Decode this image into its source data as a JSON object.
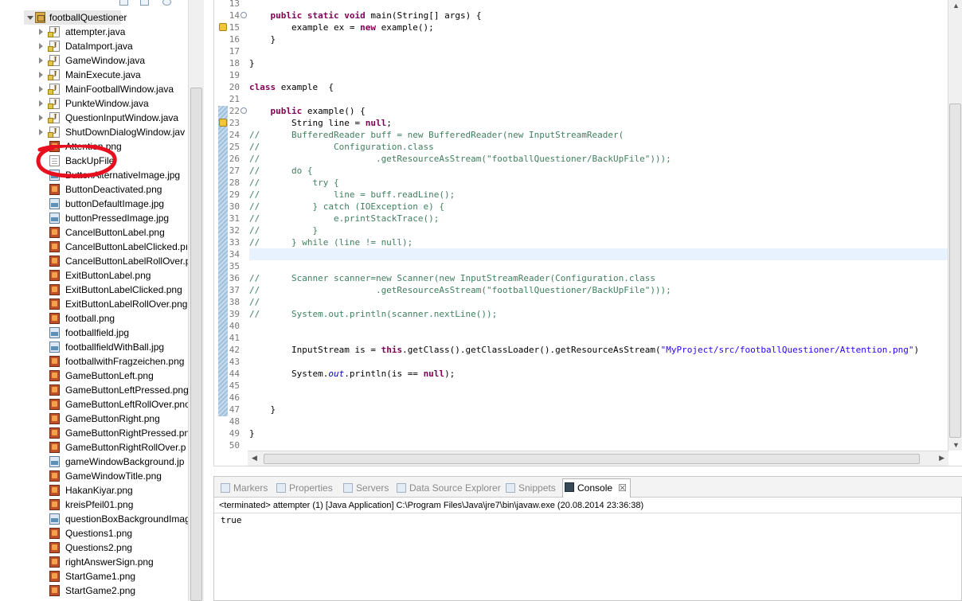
{
  "explorer": {
    "project": "footballQuestioner",
    "items": [
      {
        "label": "attempter.java",
        "type": "java",
        "expandable": true
      },
      {
        "label": "DataImport.java",
        "type": "java",
        "expandable": true
      },
      {
        "label": "GameWindow.java",
        "type": "java",
        "expandable": true
      },
      {
        "label": "MainExecute.java",
        "type": "java",
        "expandable": true
      },
      {
        "label": "MainFootballWindow.java",
        "type": "java",
        "expandable": true
      },
      {
        "label": "PunkteWindow.java",
        "type": "java",
        "expandable": true
      },
      {
        "label": "QuestionInputWindow.java",
        "type": "java",
        "expandable": true
      },
      {
        "label": "ShutDownDialogWindow.jav",
        "type": "java",
        "expandable": true
      },
      {
        "label": "Attention.png",
        "type": "png"
      },
      {
        "label": "BackUpFile",
        "type": "file"
      },
      {
        "label": "ButtonAlternativeImage.jpg",
        "type": "jpg"
      },
      {
        "label": "ButtonDeactivated.png",
        "type": "png"
      },
      {
        "label": "buttonDefaultImage.jpg",
        "type": "jpg"
      },
      {
        "label": "buttonPressedImage.jpg",
        "type": "jpg"
      },
      {
        "label": "CancelButtonLabel.png",
        "type": "png"
      },
      {
        "label": "CancelButtonLabelClicked.pı",
        "type": "png"
      },
      {
        "label": "CancelButtonLabelRollOver.p",
        "type": "png"
      },
      {
        "label": "ExitButtonLabel.png",
        "type": "png"
      },
      {
        "label": "ExitButtonLabelClicked.png",
        "type": "png"
      },
      {
        "label": "ExitButtonLabelRollOver.png",
        "type": "png"
      },
      {
        "label": "football.png",
        "type": "png"
      },
      {
        "label": "footballfield.jpg",
        "type": "jpg"
      },
      {
        "label": "footballfieldWithBall.jpg",
        "type": "jpg"
      },
      {
        "label": "footballwithFragzeichen.png",
        "type": "png"
      },
      {
        "label": "GameButtonLeft.png",
        "type": "png"
      },
      {
        "label": "GameButtonLeftPressed.png",
        "type": "png"
      },
      {
        "label": "GameButtonLeftRollOver.pno",
        "type": "png"
      },
      {
        "label": "GameButtonRight.png",
        "type": "png"
      },
      {
        "label": "GameButtonRightPressed.pn",
        "type": "png"
      },
      {
        "label": "GameButtonRightRollOver.p",
        "type": "png"
      },
      {
        "label": "gameWindowBackground.jp",
        "type": "jpg"
      },
      {
        "label": "GameWindowTitle.png",
        "type": "png"
      },
      {
        "label": "HakanKiyar.png",
        "type": "png"
      },
      {
        "label": "kreisPfeil01.png",
        "type": "png"
      },
      {
        "label": "questionBoxBackgroundImag",
        "type": "jpg"
      },
      {
        "label": "Questions1.png",
        "type": "png"
      },
      {
        "label": "Questions2.png",
        "type": "png"
      },
      {
        "label": "rightAnswerSign.png",
        "type": "png"
      },
      {
        "label": "StartGame1.png",
        "type": "png"
      },
      {
        "label": "StartGame2.png",
        "type": "png"
      }
    ]
  },
  "editor": {
    "lines": [
      {
        "n": "13",
        "tokens": []
      },
      {
        "n": "14",
        "fold": true,
        "tokens": [
          [
            "    ",
            ""
          ],
          [
            "public",
            "kw"
          ],
          [
            " ",
            ""
          ],
          [
            "static",
            "kw"
          ],
          [
            " ",
            ""
          ],
          [
            "void",
            "kw"
          ],
          [
            " main(String[] args) {",
            ""
          ]
        ]
      },
      {
        "n": "15",
        "warn": true,
        "tokens": [
          [
            "        example ex = ",
            ""
          ],
          [
            "new",
            "kw"
          ],
          [
            " example();",
            ""
          ]
        ]
      },
      {
        "n": "16",
        "tokens": [
          [
            "    }",
            ""
          ]
        ]
      },
      {
        "n": "17",
        "tokens": []
      },
      {
        "n": "18",
        "tokens": [
          [
            "}",
            ""
          ]
        ]
      },
      {
        "n": "19",
        "tokens": []
      },
      {
        "n": "20",
        "tokens": [
          [
            "class",
            "kw"
          ],
          [
            " example  {",
            ""
          ]
        ]
      },
      {
        "n": "21",
        "tokens": []
      },
      {
        "n": "22",
        "fold": true,
        "tokens": [
          [
            "    ",
            ""
          ],
          [
            "public",
            "kw"
          ],
          [
            " example() {",
            ""
          ]
        ]
      },
      {
        "n": "23",
        "warn": true,
        "tokens": [
          [
            "        String line = ",
            ""
          ],
          [
            "null",
            "kw"
          ],
          [
            ";",
            ""
          ]
        ]
      },
      {
        "n": "24",
        "tokens": [
          [
            "//      BufferedReader buff = new BufferedReader(new InputStreamReader(",
            "cm"
          ]
        ]
      },
      {
        "n": "25",
        "tokens": [
          [
            "//              Configuration.class",
            "cm"
          ]
        ]
      },
      {
        "n": "26",
        "tokens": [
          [
            "//                      .getResourceAsStream(\"footballQuestioner/BackUpFile\")));",
            "cm"
          ]
        ]
      },
      {
        "n": "27",
        "tokens": [
          [
            "//      do {",
            "cm"
          ]
        ]
      },
      {
        "n": "28",
        "tokens": [
          [
            "//          try {",
            "cm"
          ]
        ]
      },
      {
        "n": "29",
        "tokens": [
          [
            "//              line = buff.readLine();",
            "cm"
          ]
        ]
      },
      {
        "n": "30",
        "tokens": [
          [
            "//          } catch (IOException e) {",
            "cm"
          ]
        ]
      },
      {
        "n": "31",
        "tokens": [
          [
            "//              e.printStackTrace();",
            "cm"
          ]
        ]
      },
      {
        "n": "32",
        "tokens": [
          [
            "//          }",
            "cm"
          ]
        ]
      },
      {
        "n": "33",
        "tokens": [
          [
            "//      } while (line != null);",
            "cm"
          ]
        ]
      },
      {
        "n": "34",
        "tokens": []
      },
      {
        "n": "35",
        "tokens": []
      },
      {
        "n": "36",
        "tokens": [
          [
            "//      Scanner scanner=new Scanner(new InputStreamReader(Configuration.class",
            "cm"
          ]
        ]
      },
      {
        "n": "37",
        "tokens": [
          [
            "//                      .getResourceAsStream(\"footballQuestioner/BackUpFile\")));",
            "cm"
          ]
        ]
      },
      {
        "n": "38",
        "tokens": [
          [
            "//",
            "cm"
          ]
        ]
      },
      {
        "n": "39",
        "tokens": [
          [
            "//      System.out.println(scanner.nextLine());",
            "cm"
          ]
        ]
      },
      {
        "n": "40",
        "tokens": []
      },
      {
        "n": "41",
        "tokens": []
      },
      {
        "n": "42",
        "tokens": [
          [
            "        InputStream is = ",
            ""
          ],
          [
            "this",
            "kw"
          ],
          [
            ".getClass().getClassLoader().getResourceAsStream(",
            ""
          ],
          [
            "\"MyProject/src/footballQuestioner/Attention.png\"",
            "st"
          ],
          [
            ")",
            ""
          ]
        ]
      },
      {
        "n": "43",
        "tokens": []
      },
      {
        "n": "44",
        "tokens": [
          [
            "        System.",
            ""
          ],
          [
            "out",
            "it"
          ],
          [
            ".println(is == ",
            ""
          ],
          [
            "null",
            "kw"
          ],
          [
            ");",
            ""
          ]
        ]
      },
      {
        "n": "45",
        "tokens": []
      },
      {
        "n": "46",
        "tokens": []
      },
      {
        "n": "47",
        "tokens": [
          [
            "    }",
            ""
          ]
        ]
      },
      {
        "n": "48",
        "tokens": []
      },
      {
        "n": "49",
        "tokens": [
          [
            "}",
            ""
          ]
        ]
      },
      {
        "n": "50",
        "tokens": []
      }
    ]
  },
  "console": {
    "tabs": [
      {
        "label": "Markers",
        "name": "tab-markers"
      },
      {
        "label": "Properties",
        "name": "tab-properties"
      },
      {
        "label": "Servers",
        "name": "tab-servers"
      },
      {
        "label": "Data Source Explorer",
        "name": "tab-data-source-explorer"
      },
      {
        "label": "Snippets",
        "name": "tab-snippets"
      },
      {
        "label": "Console",
        "name": "tab-console",
        "active": true,
        "close": "☒"
      }
    ],
    "header": "<terminated> attempter (1) [Java Application] C:\\Program Files\\Java\\jre7\\bin\\javaw.exe (20.08.2014 23:36:38)",
    "output": "true"
  },
  "colors": {
    "keyword": "#7f0055",
    "comment": "#3f7f5f",
    "string": "#2a00ff",
    "highlight_line": "#e8f2fe",
    "red_annotation": "#e8101e"
  },
  "icons": {
    "tree_expand": "triangle-right-icon",
    "java_file": "java-file-icon",
    "png_file": "png-image-icon",
    "jpg_file": "jpg-image-icon",
    "plain_file": "text-file-icon",
    "project": "package-folder-icon"
  }
}
